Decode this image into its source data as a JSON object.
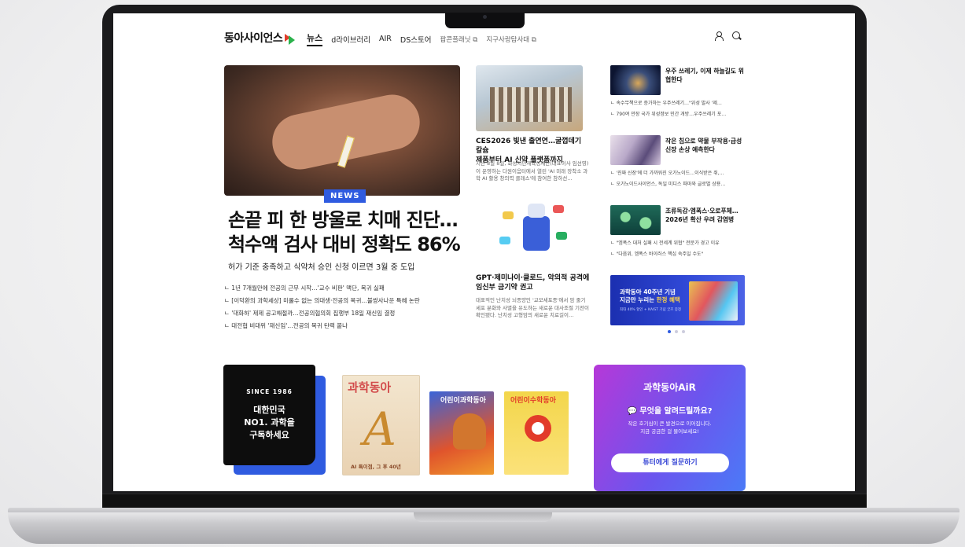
{
  "site": {
    "logo": "동아사이언스"
  },
  "nav": {
    "items": [
      "뉴스",
      "d라이브러리",
      "AIR",
      "DS스토어",
      "팝콘플래닛",
      "지구사랑탐사대"
    ]
  },
  "hero": {
    "badge": "NEWS",
    "headline_1": "손끝 피 한 방울로 치매 진단…",
    "headline_2": "척수액 검사 대비 정확도 86%",
    "subhead": "허가 기준 충족하고 식약처 승인 신청 이르면 3월 중 도입",
    "related": [
      "1년 7개월만에 전공의 근무 시작…'교수 비판' 맥단, 복귀 실패",
      "[이덕환의 과학세상] 미룰수 없는 의대생·전공의 복귀…불쌍사나운 특혜 논란",
      "'대화하' 제제 공고해절까…전공의협의회 집행부 18일 재신임 결정",
      "대전협 비대위 '재신임'…전공의 복귀 탄력 붙나"
    ]
  },
  "mid": [
    {
      "title_1": "CES2026 빛낸 출연연…굴껍데기 칼슘",
      "title_2": "제품부터 AI 신약 플랫폼까지",
      "desc": "지난 8일 8일, 화성시민재육성재단(대표이사 임선영)이 운영하는 다원이음터에서 열린 'AI 미래 장착소 과학 AI 활용 창의력 클래스'에 참여한 참하선…"
    },
    {
      "title_1": "GPT·제미나이·클로드, 악의적 공격에",
      "title_2": "임신부 금기약 권고",
      "desc": "대표적인 난치성 뇌종양인 '교모세포종'에서 암 줄기세포 분화와 사멸을 유도하는 새로운 대사조절 기전이 확인됐다. 난치성 고형암의 새로운 치료길이…"
    }
  ],
  "side": [
    {
      "title": "우주 쓰레기, 이제 하늘길도 위협한다",
      "subs": [
        "속수무책으로 증가하는 우주쓰레기…\"위성 발사 '제…",
        "790여 만장 국가 위성정보 민간 개방…우주쓰레기 포…"
      ]
    },
    {
      "title": "작은 칩으로 약물 부작용·급성 신장 손상 예측한다",
      "subs": [
        "'진짜 신장'에 더 가까워진 오가노이드…이식받은 쥐,…",
        "오가노이드사이언스, 독일 미디스 파마와 글로벌 상용…"
      ]
    },
    {
      "title": "조류독감·엠폭스·오로푸체…2026년 확산 우려 감염병",
      "subs": [
        "\"엠폭스 대처 실패 시 전세계 위협\" 전문가 경고 이유",
        "\"다음위, 엠폭스 바이러스 핵심 숙주일 수도\""
      ]
    }
  ],
  "banner": {
    "line_1": "과학동아 40주년 기념",
    "line_2_a": "지금만 누리는 ",
    "line_2_b": "한정 혜택",
    "small": "최대 40% 할인 + KAIST 기념 굿즈 증정"
  },
  "subscribe": {
    "since": "SINCE 1986",
    "line_1": "대한민국",
    "line_2": "NO1. 과학을",
    "line_3": "구독하세요"
  },
  "magazines": {
    "m1_title": "과학동아",
    "m1_caption": "AI 특이점, 그 후 40년",
    "m2_title": "어린이과학동아",
    "m3_title": "어린이수학동아"
  },
  "air": {
    "logo": "과학동아AiR",
    "question": "무엇을 알려드릴까요?",
    "desc_1": "작은 호기심이 큰 발견으로 이어집니다.",
    "desc_2": "지금 궁금한 걸 물어보세요!",
    "button": "튜터에게 질문하기"
  },
  "colors": {
    "accent": "#2f5be0",
    "brand_red": "#e23b2a",
    "brand_green": "#2bb24c"
  }
}
